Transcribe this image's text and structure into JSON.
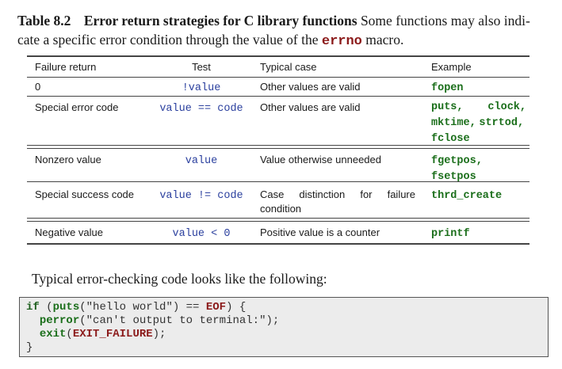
{
  "caption": {
    "label": "Table 8.2",
    "title": "Error return strategies for C library functions",
    "text_before_code": "Some functions may also indi-",
    "text_line2": "cate a specific error condition through the value of the",
    "code_word": "errno",
    "text_after_code": "macro."
  },
  "table": {
    "headers": [
      "Failure return",
      "Test",
      "Typical case",
      "Example"
    ],
    "rows": [
      {
        "failure": "0",
        "test": "!value",
        "typical": "Other values are valid",
        "example": [
          "fopen"
        ]
      },
      {
        "failure": "Special error code",
        "test": "value == code",
        "typical": "Other values are valid",
        "example": [
          "puts,",
          "clock,",
          "mktime,",
          "strtod,",
          "fclose"
        ]
      },
      {
        "failure": "Nonzero value",
        "test": "value",
        "typical": "Value otherwise unneeded",
        "example": [
          "fgetpos,",
          "fsetpos"
        ]
      },
      {
        "failure": "Special success code",
        "test": "value != code",
        "typical": "Case distinction for failure condition",
        "example": [
          "thrd_create"
        ]
      },
      {
        "failure": "Negative value",
        "test": "value < 0",
        "typical": "Positive value is a counter",
        "example": [
          "printf"
        ]
      }
    ]
  },
  "typical_text": "Typical error-checking code looks like the following:",
  "code": {
    "line1": {
      "kw": "if",
      "p1": " (",
      "fn": "puts",
      "p2": "(\"hello world\") == ",
      "const": "EOF",
      "p3": ") {"
    },
    "line2": {
      "fn": "perror",
      "p": "(\"can't output to terminal:\");"
    },
    "line3": {
      "fn": "exit",
      "p1": "(",
      "const": "EXIT_FAILURE",
      "p2": ");"
    },
    "line4": "}"
  }
}
